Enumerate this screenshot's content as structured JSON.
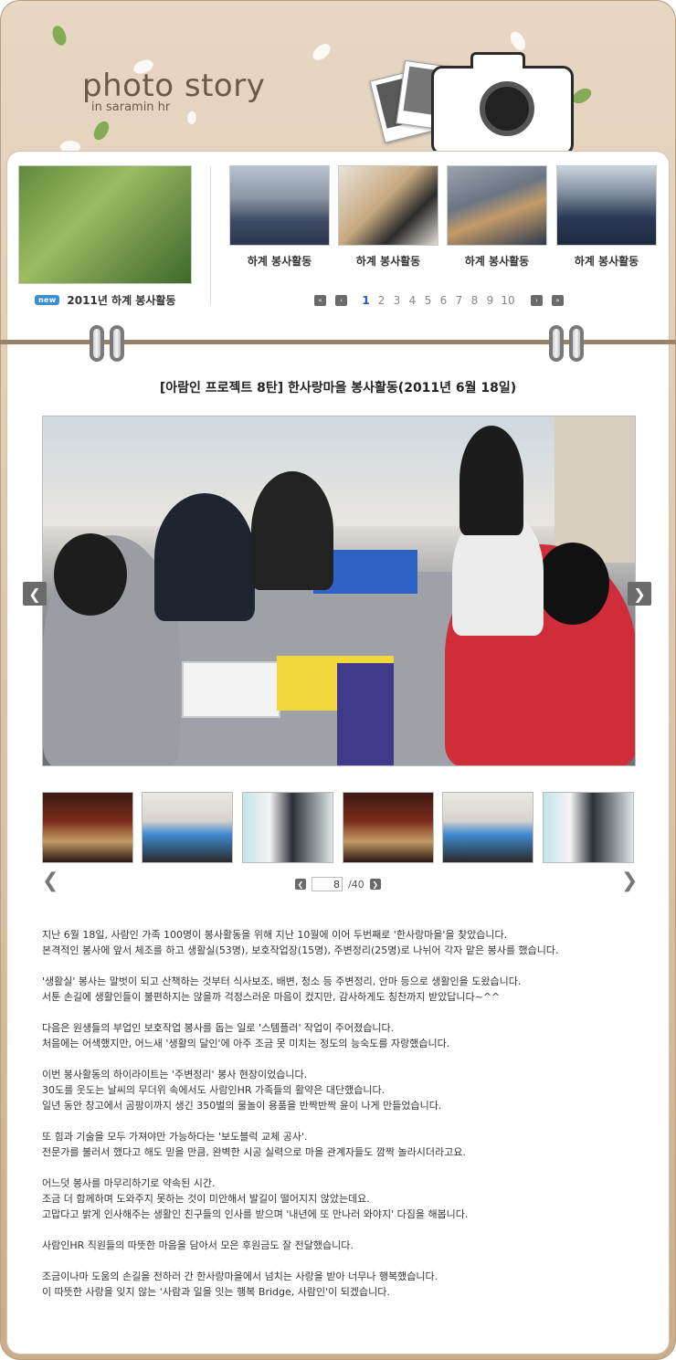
{
  "header": {
    "title": "photo story",
    "subtitle": "in saramin hr"
  },
  "gallery": {
    "featured": {
      "badge": "new",
      "caption": "2011년 하계 봉사활동"
    },
    "thumbs": [
      {
        "caption": "하계 봉사활동"
      },
      {
        "caption": "하계 봉사활동"
      },
      {
        "caption": "하계 봉사활동"
      },
      {
        "caption": "하계 봉사활동"
      }
    ],
    "pager": {
      "first": "«",
      "prev": "‹",
      "pages": [
        "1",
        "2",
        "3",
        "4",
        "5",
        "6",
        "7",
        "8",
        "9",
        "10"
      ],
      "active_page": "1",
      "next": "›",
      "last": "»"
    }
  },
  "post": {
    "title": "[아람인 프로젝트 8탄] 한사랑마을 봉사활동(2011년 6월 18일)",
    "photo_counter": {
      "current": "8",
      "total": "/40"
    },
    "paragraphs": [
      [
        "지난 6월 18일, 사람인 가족 100명이 봉사활동을 위해 지난 10월에 이어 두번째로 '한사랑마을'을 찾았습니다.",
        "본격적인 봉사에 앞서 체조를 하고 생활실(53명), 보호작업장(15명), 주변정리(25명)로 나뉘어 각자 맡은 봉사를 했습니다."
      ],
      [
        "'생활실' 봉사는 말벗이 되고 산책하는 것부터 식사보조, 배변, 청소 등 주변정리, 안마 등으로 생활인을 도왔습니다.",
        "서툰 손길에 생활인들이 불편하지는 않을까 걱정스러운 마음이 컸지만, 감사하게도 칭찬까지 받았답니다~^^"
      ],
      [
        "다음은 원생들의 부업인 보호작업 봉사를 돕는 일로 '스템플러' 작업이 주어졌습니다.",
        "처음에는 어색했지만, 어느새 '생활의 달인'에 아주 조금 못 미치는 정도의 능숙도를 자랑했습니다."
      ],
      [
        "이번 봉사활동의 하이라이트는 '주변정리' 봉사 현장이었습니다.",
        "30도를 웃도는 날씨의 무더위 속에서도 사람인HR 가족들의 활약은 대단했습니다.",
        "일년 동안 창고에서 곰팡이까지 생긴 350벌의 물놀이 용품을 반짝반짝 윤이 나게 만들었습니다."
      ],
      [
        "또 힘과 기술을 모두 가져야만 가능하다는 '보도블럭 교체 공사'.",
        "전문가를 불러서 했다고 해도 믿을 만큼, 완벽한 시공 실력으로 마을 관계자들도 깜짝 놀라시더라고요."
      ],
      [
        "어느덧 봉사를 마무리하기로 약속된 시간.",
        "조금 더 함께하며 도와주지 못하는 것이 미안해서 발길이 떨어지지 않았는데요.",
        "고맙다고 밝게 인사해주는 생활인 친구들의 인사를 받으며 '내년에 또 만나러 와야지' 다짐을 해봅니다."
      ],
      [
        "사람인HR 직원들의 따뜻한 마음을 담아서 모은 후원금도 잘 전달했습니다."
      ],
      [
        "조금이나마 도움의 손길을 전하러 간 한사랑마을에서 넘치는 사랑을 받아 너무나 행복했습니다.",
        "이 따뜻한 사랑을 잊지 않는 '사람과 일을 잇는 행복 Bridge, 사람인'이 되겠습니다."
      ]
    ]
  },
  "icons": {
    "prev": "chevron-left-icon",
    "next": "chevron-right-icon",
    "camera": "camera-icon"
  }
}
